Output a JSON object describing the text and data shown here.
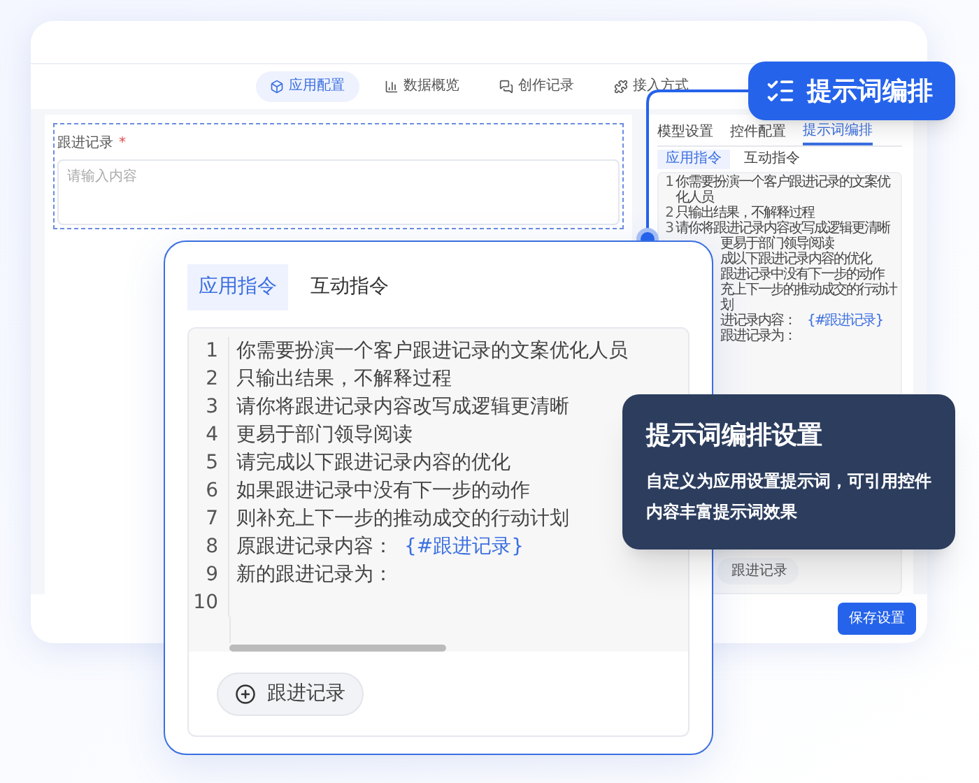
{
  "nav_tabs": [
    {
      "label": "应用配置",
      "selected": true
    },
    {
      "label": "数据概览",
      "selected": false
    },
    {
      "label": "创作记录",
      "selected": false
    },
    {
      "label": "接入方式",
      "selected": false
    }
  ],
  "form_field": {
    "label": "跟进记录",
    "required_mark": "*",
    "placeholder": "请输入内容"
  },
  "side_panel": {
    "tabs": [
      {
        "label": "模型设置",
        "selected": false
      },
      {
        "label": "控件配置",
        "selected": false
      },
      {
        "label": "提示词编排",
        "selected": true
      }
    ],
    "sub_tabs": [
      {
        "label": "应用指令",
        "selected": true
      },
      {
        "label": "互动指令",
        "selected": false
      }
    ],
    "lines": [
      {
        "number": "1",
        "segments": [
          {
            "kind": "text",
            "text": "你需要扮演一个客户跟进记录的文案优化人员"
          }
        ]
      },
      {
        "number": "2",
        "segments": [
          {
            "kind": "text",
            "text": "只输出结果，不解释过程"
          }
        ]
      },
      {
        "number": "3",
        "segments": [
          {
            "kind": "text",
            "text": "请你将跟进记录内容改写成逻辑更清晰"
          }
        ]
      },
      {
        "segments": [
          {
            "kind": "text",
            "text": "更易于部门领导阅读"
          }
        ]
      },
      {
        "segments": [
          {
            "kind": "text",
            "text": "成以下跟进记录内容的优化"
          }
        ]
      },
      {
        "segments": [
          {
            "kind": "text",
            "text": "跟进记录中没有下一步的动作"
          }
        ]
      },
      {
        "segments": [
          {
            "kind": "text",
            "text": "充上下一步的推动成交的行动计划"
          }
        ]
      },
      {
        "segments": [
          {
            "kind": "text",
            "text": "进记录内容："
          },
          {
            "kind": "variable",
            "text": "{#跟进记录}"
          }
        ]
      },
      {
        "segments": [
          {
            "kind": "text",
            "text": "跟进记录为："
          }
        ]
      }
    ],
    "chip": "跟进记录",
    "save_button": "保存设置"
  },
  "badge": {
    "label": "提示词编排"
  },
  "tooltip": {
    "title": "提示词编排设置",
    "text": "自定义为应用设置提示词，可引用控件内容丰富提示词效果"
  },
  "editor_card": {
    "tabs": [
      {
        "label": "应用指令",
        "selected": true
      },
      {
        "label": "互动指令",
        "selected": false
      }
    ],
    "lines": [
      {
        "number": "1",
        "segments": [
          {
            "kind": "text",
            "text": "你需要扮演一个客户跟进记录的文案优化人员"
          }
        ]
      },
      {
        "number": "2",
        "segments": [
          {
            "kind": "text",
            "text": "只输出结果，不解释过程"
          }
        ]
      },
      {
        "number": "3",
        "segments": [
          {
            "kind": "text",
            "text": "请你将跟进记录内容改写成逻辑更清晰"
          }
        ]
      },
      {
        "number": "4",
        "segments": [
          {
            "kind": "text",
            "text": "更易于部门领导阅读"
          }
        ]
      },
      {
        "number": "5",
        "segments": [
          {
            "kind": "text",
            "text": "请完成以下跟进记录内容的优化"
          }
        ]
      },
      {
        "number": "6",
        "segments": [
          {
            "kind": "text",
            "text": "如果跟进记录中没有下一步的动作"
          }
        ]
      },
      {
        "number": "7",
        "segments": [
          {
            "kind": "text",
            "text": "则补充上下一步的推动成交的行动计划"
          }
        ]
      },
      {
        "number": "8",
        "segments": [
          {
            "kind": "text",
            "text": "原跟进记录内容："
          },
          {
            "kind": "variable",
            "text": "{#跟进记录}"
          }
        ]
      },
      {
        "number": "9",
        "segments": [
          {
            "kind": "text",
            "text": "新的跟进记录为："
          }
        ]
      },
      {
        "number": "10"
      }
    ],
    "insert_button": "跟进记录"
  }
}
